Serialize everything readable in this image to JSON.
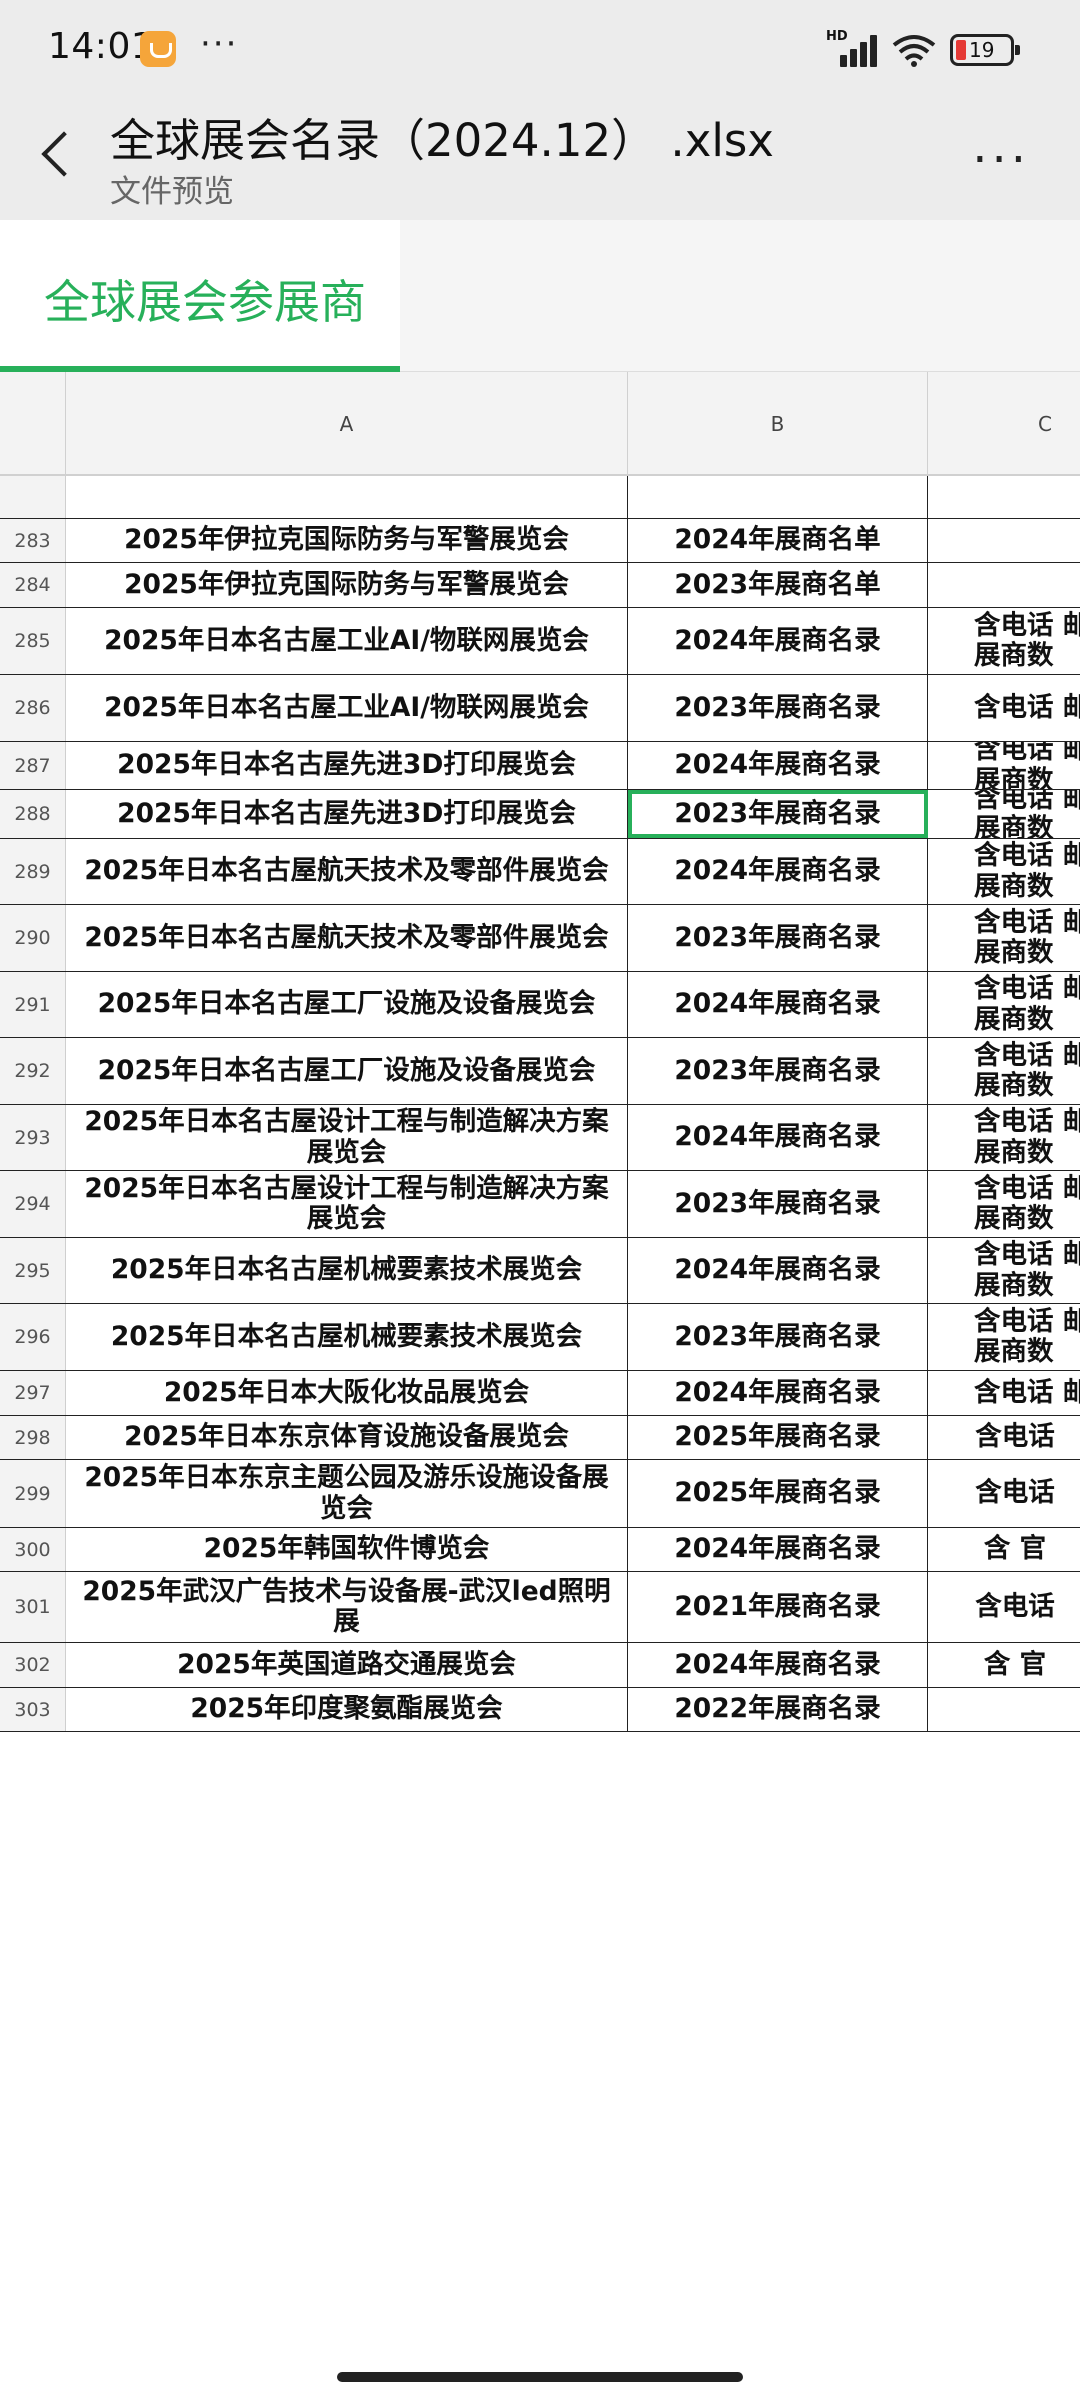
{
  "status_bar": {
    "time": "14:01",
    "more": "···",
    "network_label": "HD",
    "battery_level": "19"
  },
  "header": {
    "title": "全球展会名录（2024.12） .xlsx",
    "subtitle": "文件预览",
    "more": "···"
  },
  "sheet_tab": {
    "label": "全球展会参展商",
    "accent": "#27b05a"
  },
  "columns": [
    "A",
    "B",
    "C"
  ],
  "rows": [
    {
      "num": "",
      "a": "",
      "b": "",
      "c": ""
    },
    {
      "num": "283",
      "a": "2025年伊拉克国际防务与军警展览会",
      "b": "2024年展商名单",
      "c": ""
    },
    {
      "num": "284",
      "a": "2025年伊拉克国际防务与军警展览会",
      "b": "2023年展商名单",
      "c": ""
    },
    {
      "num": "285",
      "a": "2025年日本名古屋工业AI/物联网展览会",
      "b": "2024年展商名录",
      "c": "含电话 邮\n展商数"
    },
    {
      "num": "286",
      "a": "2025年日本名古屋工业AI/物联网展览会",
      "b": "2023年展商名录",
      "c": "含电话 邮"
    },
    {
      "num": "287",
      "a": "2025年日本名古屋先进3D打印展览会",
      "b": "2024年展商名录",
      "c": "含电话 邮\n展商数"
    },
    {
      "num": "288",
      "a": "2025年日本名古屋先进3D打印展览会",
      "b": "2023年展商名录",
      "c": "含电话 邮\n展商数"
    },
    {
      "num": "289",
      "a": "2025年日本名古屋航天技术及零部件展览会",
      "b": "2024年展商名录",
      "c": "含电话 邮\n展商数"
    },
    {
      "num": "290",
      "a": "2025年日本名古屋航天技术及零部件展览会",
      "b": "2023年展商名录",
      "c": "含电话 邮\n展商数"
    },
    {
      "num": "291",
      "a": "2025年日本名古屋工厂设施及设备展览会",
      "b": "2024年展商名录",
      "c": "含电话 邮\n展商数"
    },
    {
      "num": "292",
      "a": "2025年日本名古屋工厂设施及设备展览会",
      "b": "2023年展商名录",
      "c": "含电话 邮\n展商数"
    },
    {
      "num": "293",
      "a": "2025年日本名古屋设计工程与制造解决方案展览会",
      "b": "2024年展商名录",
      "c": "含电话 邮\n展商数"
    },
    {
      "num": "294",
      "a": "2025年日本名古屋设计工程与制造解决方案展览会",
      "b": "2023年展商名录",
      "c": "含电话 邮\n展商数"
    },
    {
      "num": "295",
      "a": "2025年日本名古屋机械要素技术展览会",
      "b": "2024年展商名录",
      "c": "含电话 邮\n展商数"
    },
    {
      "num": "296",
      "a": "2025年日本名古屋机械要素技术展览会",
      "b": "2023年展商名录",
      "c": "含电话 邮\n展商数"
    },
    {
      "num": "297",
      "a": "2025年日本大阪化妆品展览会",
      "b": "2024年展商名录",
      "c": "含电话 邮"
    },
    {
      "num": "298",
      "a": "2025年日本东京体育设施设备展览会",
      "b": "2025年展商名录",
      "c": "含电话"
    },
    {
      "num": "299",
      "a": "2025年日本东京主题公园及游乐设施设备展览会",
      "b": "2025年展商名录",
      "c": "含电话"
    },
    {
      "num": "300",
      "a": "2025年韩国软件博览会",
      "b": "2024年展商名录",
      "c": "含 官"
    },
    {
      "num": "301",
      "a": "2025年武汉广告技术与设备展-武汉led照明展",
      "b": "2021年展商名录",
      "c": "含电话"
    },
    {
      "num": "302",
      "a": "2025年英国道路交通展览会",
      "b": "2024年展商名录",
      "c": "含 官"
    },
    {
      "num": "303",
      "a": "2025年印度聚氨酯展览会",
      "b": "2022年展商名录",
      "c": ""
    }
  ],
  "selected_cell": "B288"
}
